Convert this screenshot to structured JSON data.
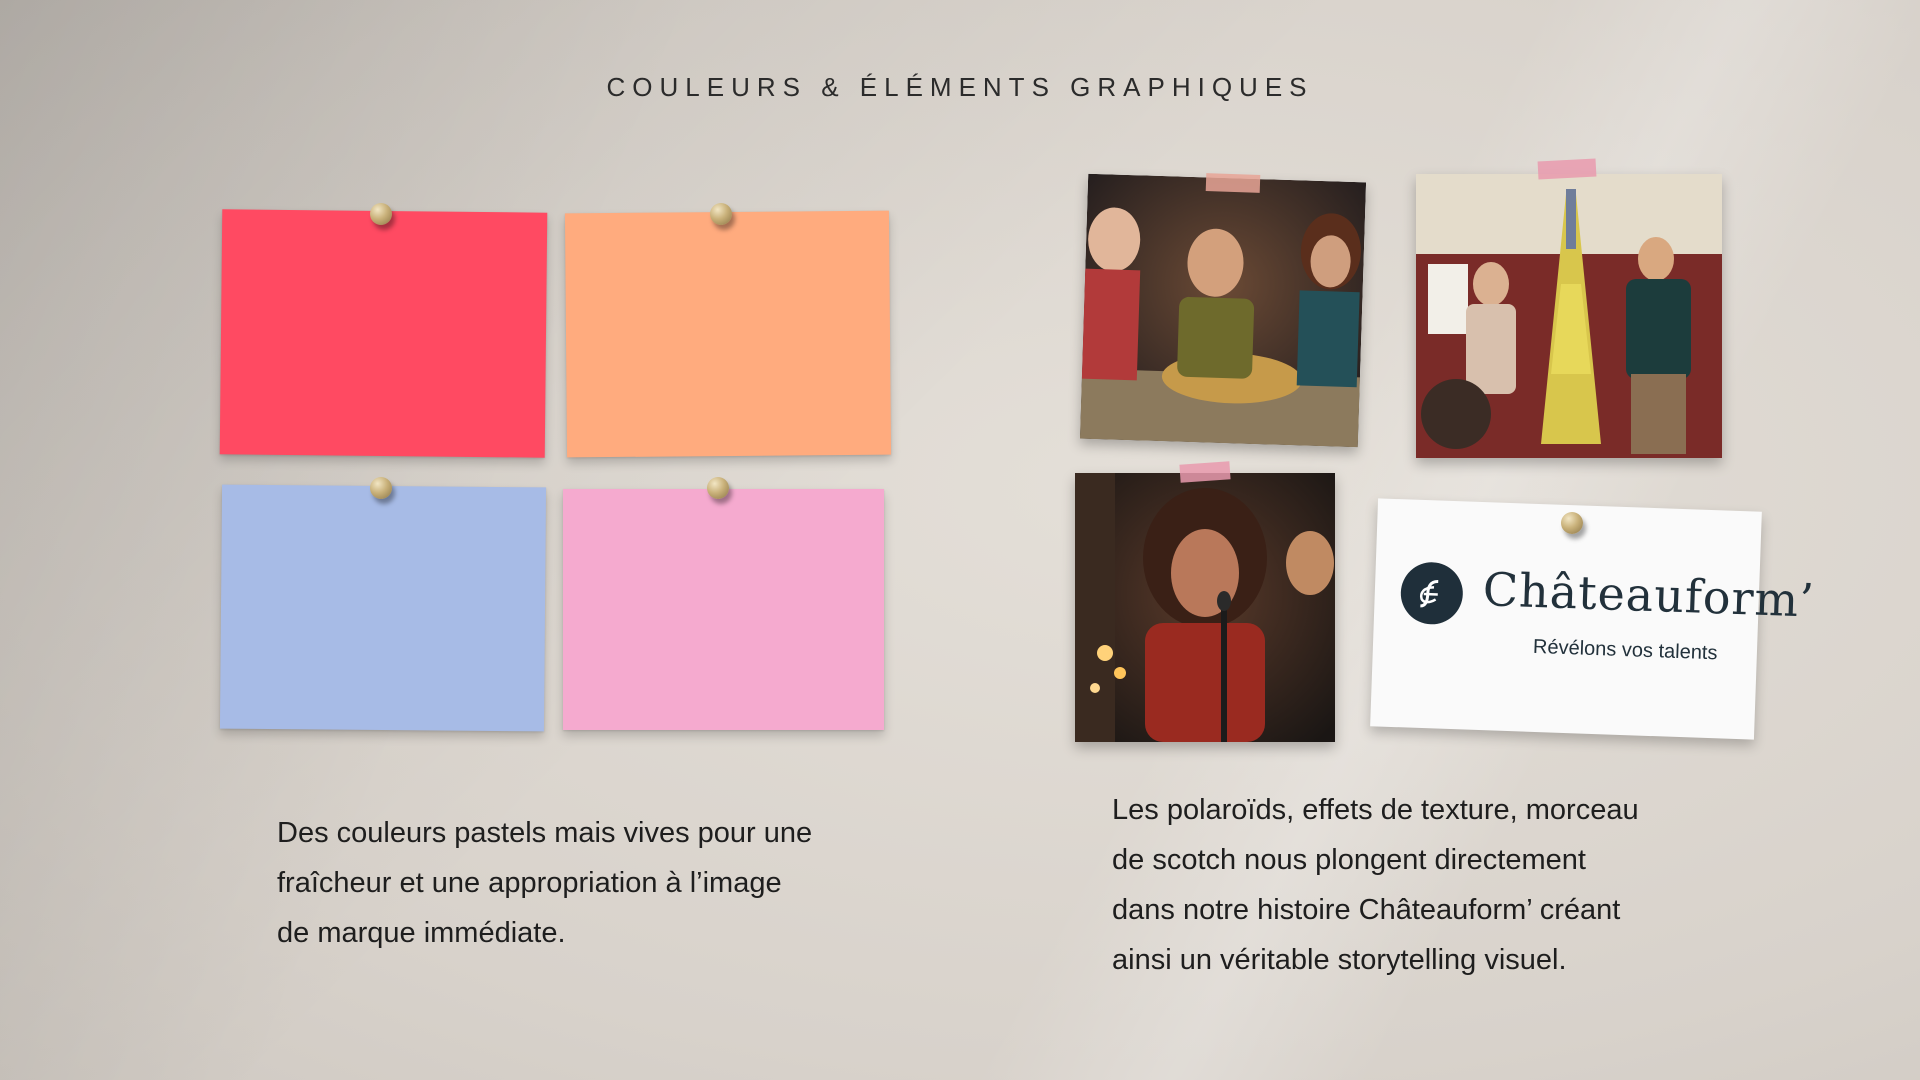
{
  "title": "COULEURS & ÉLÉMENTS GRAPHIQUES",
  "colors": {
    "red": "#FF4A62",
    "orange": "#FFAB7E",
    "blue": "#A7BBE6",
    "pink": "#F5AACF",
    "tape_salmon": "#E8A596",
    "tape_pink": "#E99AAE"
  },
  "photos": [
    {
      "name": "dinner-party-photo",
      "alt": ""
    },
    {
      "name": "eiffel-tower-sticky-notes-photo",
      "alt": ""
    },
    {
      "name": "singer-microphone-photo",
      "alt": ""
    }
  ],
  "logo": {
    "name": "Châteauform’",
    "tagline": "Révélons vos talents",
    "icon": "chateauform-logo-icon"
  },
  "left_text": {
    "line1": "Des couleurs pastels mais vives pour une",
    "line2": "fraîcheur et une appropriation à l’image",
    "line3": "de marque immédiate."
  },
  "right_text": {
    "line1": "Les polaroïds, effets de texture, morceau",
    "line2": "de scotch nous plongent directement",
    "line3": "dans notre histoire Châteauform’ créant",
    "line4": "ainsi un véritable storytelling visuel."
  }
}
